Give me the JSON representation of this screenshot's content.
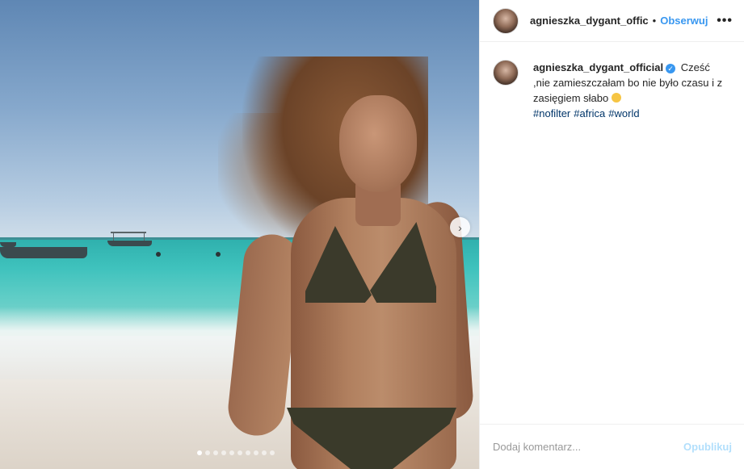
{
  "post": {
    "username_short": "agnieszka_dygant_offic",
    "separator": "•",
    "follow_label": "Obserwuj",
    "more_label": "•••"
  },
  "caption": {
    "username": "agnieszka_dygant_official",
    "verified_mark": "✓",
    "text": "Cześć ,nie zamieszczałam bo nie było czasu i z zasięgiem słabo",
    "hashtags": [
      "#nofilter",
      "#africa",
      "#world"
    ]
  },
  "carousel": {
    "next_label": "›",
    "slide_count": 10,
    "active_index": 0
  },
  "comment": {
    "placeholder": "Dodaj komentarz...",
    "post_label": "Opublikuj"
  },
  "colors": {
    "accent": "#3897f0",
    "hashtag": "#003569",
    "post_disabled": "#b2dffc"
  },
  "icons": {
    "verified": "verified-badge-icon",
    "emoji": "grinning-face-emoji-icon",
    "next": "chevron-right-icon",
    "more": "more-options-icon"
  }
}
